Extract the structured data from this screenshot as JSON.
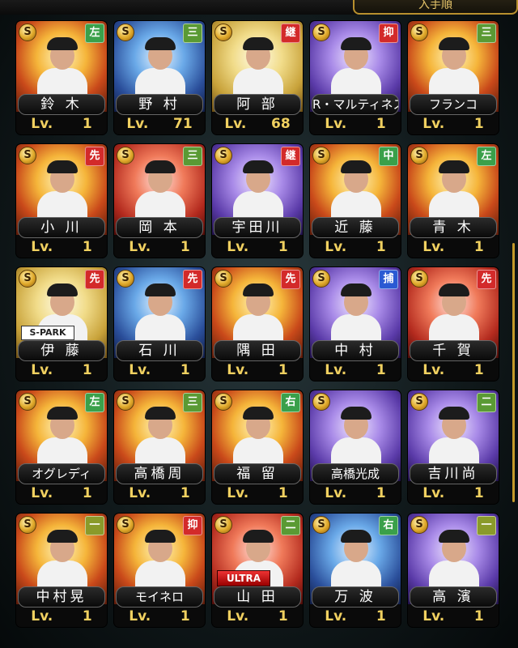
{
  "header": {
    "badge_text": "入手順"
  },
  "colors": {
    "pos_left": "#3aa04a",
    "pos_three": "#4e8f3a",
    "pos_succession": "#d32a2a",
    "pos_closer": "#d32a2a",
    "pos_starter": "#d32a2a",
    "pos_center": "#3aa04a",
    "pos_catcher": "#2a5ad3",
    "pos_right": "#3aa04a",
    "pos_second": "#4e8f3a",
    "pos_first": "#4e8f3a",
    "level_text": "#f0d060"
  },
  "cards": [
    {
      "name": "鈴 木",
      "position": "左",
      "pos_color": "#3aa04a",
      "level_label": "Lv.",
      "level": "1",
      "bg": "fire",
      "coin": "S"
    },
    {
      "name": "野 村",
      "position": "三",
      "pos_color": "#5a9a34",
      "level_label": "Lv.",
      "level": "71",
      "bg": "blue",
      "coin": "S"
    },
    {
      "name": "阿 部",
      "position": "継",
      "pos_color": "#d32a2a",
      "level_label": "Lv.",
      "level": "68",
      "bg": "gold",
      "coin": "S"
    },
    {
      "name": "R・マルティネス",
      "position": "抑",
      "pos_color": "#d32a2a",
      "level_label": "Lv.",
      "level": "1",
      "bg": "purple",
      "coin": "S"
    },
    {
      "name": "フランコ",
      "position": "三",
      "pos_color": "#5a9a34",
      "level_label": "Lv.",
      "level": "1",
      "bg": "fire",
      "coin": "S"
    },
    {
      "name": "小 川",
      "position": "先",
      "pos_color": "#d32a2a",
      "level_label": "Lv.",
      "level": "1",
      "bg": "fire",
      "coin": "S"
    },
    {
      "name": "岡 本",
      "position": "三",
      "pos_color": "#5a9a34",
      "level_label": "Lv.",
      "level": "1",
      "bg": "red",
      "coin": "S"
    },
    {
      "name": "宇田川",
      "position": "継",
      "pos_color": "#d32a2a",
      "level_label": "Lv.",
      "level": "1",
      "bg": "purple",
      "coin": "S"
    },
    {
      "name": "近 藤",
      "position": "中",
      "pos_color": "#3aa04a",
      "level_label": "Lv.",
      "level": "1",
      "bg": "fire",
      "coin": "S"
    },
    {
      "name": "青 木",
      "position": "左",
      "pos_color": "#3aa04a",
      "level_label": "Lv.",
      "level": "1",
      "bg": "fire",
      "coin": "S"
    },
    {
      "name": "伊 藤",
      "position": "先",
      "pos_color": "#d32a2a",
      "level_label": "Lv.",
      "level": "1",
      "bg": "gold",
      "coin": "S",
      "tag": "S-PARK"
    },
    {
      "name": "石 川",
      "position": "先",
      "pos_color": "#d32a2a",
      "level_label": "Lv.",
      "level": "1",
      "bg": "blue",
      "coin": "S"
    },
    {
      "name": "隅 田",
      "position": "先",
      "pos_color": "#d32a2a",
      "level_label": "Lv.",
      "level": "1",
      "bg": "fire",
      "coin": "S"
    },
    {
      "name": "中 村",
      "position": "捕",
      "pos_color": "#2a5ad3",
      "level_label": "Lv.",
      "level": "1",
      "bg": "purple",
      "coin": "S"
    },
    {
      "name": "千 賀",
      "position": "先",
      "pos_color": "#d32a2a",
      "level_label": "Lv.",
      "level": "1",
      "bg": "red",
      "coin": "S"
    },
    {
      "name": "オグレディ",
      "position": "左",
      "pos_color": "#3aa04a",
      "level_label": "Lv.",
      "level": "1",
      "bg": "fire",
      "coin": "S"
    },
    {
      "name": "高橋周",
      "position": "三",
      "pos_color": "#5a9a34",
      "level_label": "Lv.",
      "level": "1",
      "bg": "fire",
      "coin": "S"
    },
    {
      "name": "福 留",
      "position": "右",
      "pos_color": "#3aa04a",
      "level_label": "Lv.",
      "level": "1",
      "bg": "fire",
      "coin": "S"
    },
    {
      "name": "高橋光成",
      "position": "",
      "pos_color": "#d32a2a",
      "level_label": "Lv.",
      "level": "1",
      "bg": "purple",
      "coin": "S"
    },
    {
      "name": "吉川尚",
      "position": "二",
      "pos_color": "#5a9a34",
      "level_label": "Lv.",
      "level": "1",
      "bg": "purple",
      "coin": "S"
    },
    {
      "name": "中村晃",
      "position": "一",
      "pos_color": "#8a9a2a",
      "level_label": "Lv.",
      "level": "1",
      "bg": "fire",
      "coin": "S"
    },
    {
      "name": "モイネロ",
      "position": "抑",
      "pos_color": "#d32a2a",
      "level_label": "Lv.",
      "level": "1",
      "bg": "fire",
      "coin": "S"
    },
    {
      "name": "山 田",
      "position": "二",
      "pos_color": "#5a9a34",
      "level_label": "Lv.",
      "level": "1",
      "bg": "red",
      "coin": "S",
      "tag": "ULTRA"
    },
    {
      "name": "万 波",
      "position": "右",
      "pos_color": "#3aa04a",
      "level_label": "Lv.",
      "level": "1",
      "bg": "blue",
      "coin": "S"
    },
    {
      "name": "高 濱",
      "position": "一",
      "pos_color": "#8a9a2a",
      "level_label": "Lv.",
      "level": "1",
      "bg": "purple",
      "coin": "S"
    }
  ]
}
